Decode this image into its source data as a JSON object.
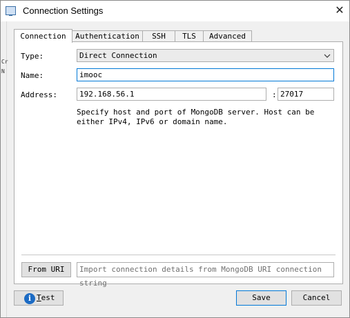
{
  "window": {
    "title": "Connection Settings",
    "close_glyph": "✕"
  },
  "background_strip": {
    "fragments": [
      "Cr",
      "N"
    ]
  },
  "tabs": [
    {
      "label": "Connection",
      "active": true
    },
    {
      "label": "Authentication"
    },
    {
      "label": "SSH"
    },
    {
      "label": "TLS"
    },
    {
      "label": "Advanced"
    }
  ],
  "form": {
    "type_label": "Type:",
    "type_value": "Direct Connection",
    "name_label": "Name:",
    "name_value": "imooc",
    "address_label": "Address:",
    "host_value": "192.168.56.1",
    "port_separator": ":",
    "port_value": "27017",
    "help_text": "Specify host and port of MongoDB server. Host can be either IPv4, IPv6 or domain name."
  },
  "uri": {
    "button_label": "From URI",
    "placeholder": "Import connection details from MongoDB URI connection string"
  },
  "footer": {
    "info_glyph": "i",
    "test_label_first": "T",
    "test_label_rest": "est",
    "save_label": "Save",
    "cancel_label": "Cancel"
  },
  "colors": {
    "accent": "#0078d7",
    "info_icon": "#1c6bc4"
  }
}
